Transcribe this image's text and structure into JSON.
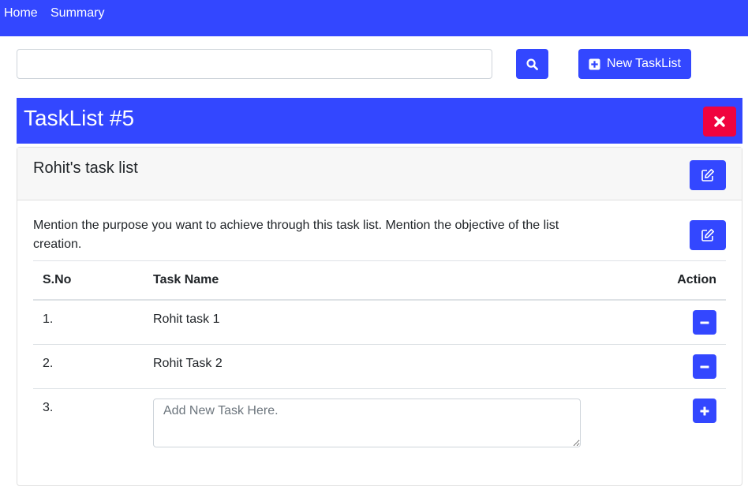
{
  "nav": {
    "home": "Home",
    "summary": "Summary"
  },
  "toolbar": {
    "search_value": "",
    "search_icon": "search-icon",
    "new_tasklist_label": "New TaskList",
    "new_tasklist_icon": "plus-square-icon"
  },
  "tasklist": {
    "header_title": "TaskList #5",
    "delete_icon": "close-icon",
    "name": "Rohit's task list",
    "description": "Mention the purpose you want to achieve through this task list. Mention the objective of the list creation.",
    "edit_icon": "edit-icon"
  },
  "table": {
    "columns": [
      "S.No",
      "Task Name",
      "Action"
    ],
    "rows": [
      {
        "sno": "1.",
        "name": "Rohit task 1",
        "action_icon": "minus-icon"
      },
      {
        "sno": "2.",
        "name": "Rohit Task 2",
        "action_icon": "minus-icon"
      }
    ],
    "new_row": {
      "sno": "3.",
      "placeholder": "Add New Task Here.",
      "action_icon": "plus-icon"
    }
  },
  "colors": {
    "primary": "#3347ff",
    "danger": "#f0033f"
  }
}
